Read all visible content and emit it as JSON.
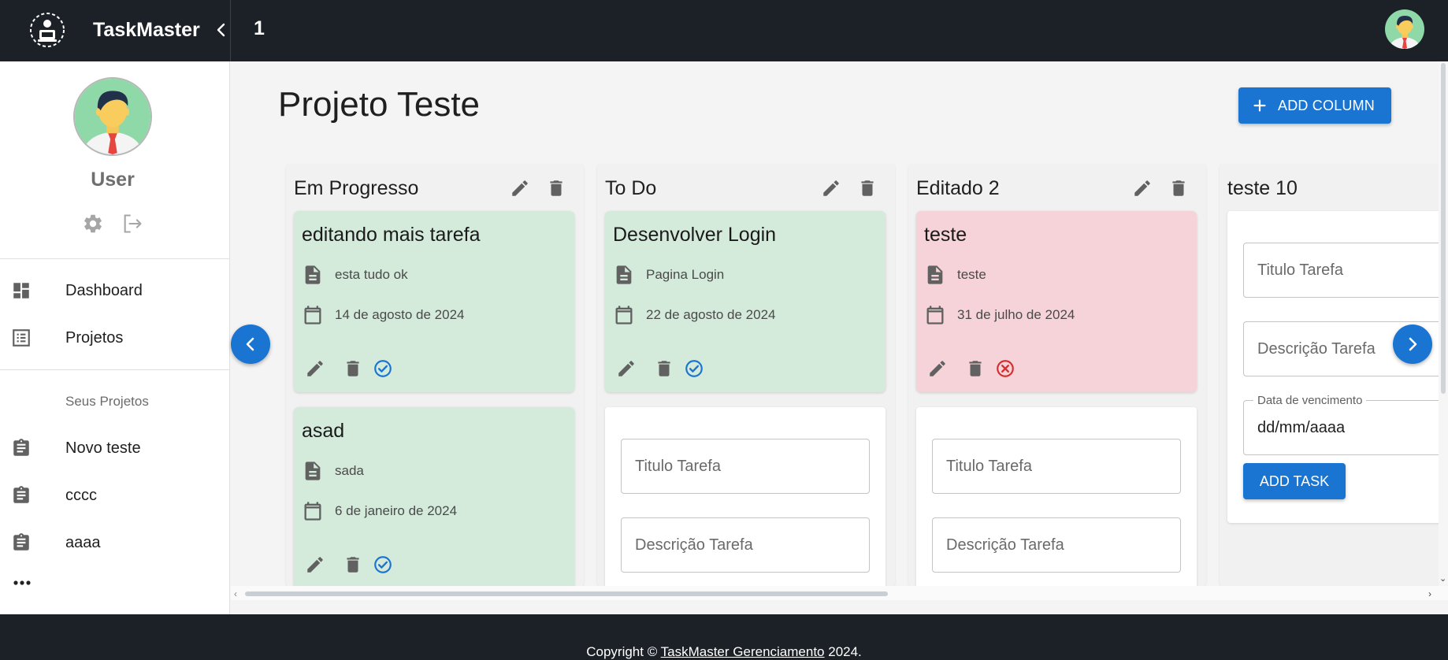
{
  "app": {
    "name": "TaskMaster",
    "page_number": "1"
  },
  "sidebar": {
    "user_name": "User",
    "nav": [
      {
        "label": "Dashboard",
        "icon": "dashboard-icon"
      },
      {
        "label": "Projetos",
        "icon": "list-icon"
      }
    ],
    "section_label": "Seus Projetos",
    "projects": [
      {
        "label": "Novo teste",
        "icon": "clipboard-icon"
      },
      {
        "label": "cccc",
        "icon": "clipboard-icon"
      },
      {
        "label": "aaaa",
        "icon": "clipboard-icon"
      }
    ]
  },
  "main": {
    "title": "Projeto Teste",
    "add_column_label": "ADD COLUMN",
    "columns": [
      {
        "title": "Em Progresso",
        "cards": [
          {
            "title": "editando mais tarefa",
            "description": "esta tudo ok",
            "date": "14 de agosto de 2024",
            "status": "done"
          },
          {
            "title": "asad",
            "description": "sada",
            "date": "6 de janeiro de 2024",
            "status": "done"
          }
        ]
      },
      {
        "title": "To Do",
        "cards": [
          {
            "title": "Desenvolver Login",
            "description": "Pagina Login",
            "date": "22 de agosto de 2024",
            "status": "done"
          }
        ],
        "form": {
          "title_placeholder": "Titulo Tarefa",
          "description_placeholder": "Descrição Tarefa"
        }
      },
      {
        "title": "Editado 2",
        "cards": [
          {
            "title": "teste",
            "description": "teste",
            "date": "31 de julho de 2024",
            "status": "overdue"
          }
        ],
        "form": {
          "title_placeholder": "Titulo Tarefa",
          "description_placeholder": "Descrição Tarefa"
        }
      },
      {
        "title": "teste 10",
        "form": {
          "title_placeholder": "Titulo Tarefa",
          "description_placeholder": "Descrição Tarefa",
          "date_label": "Data de vencimento",
          "date_value": "dd/mm/aaaa",
          "add_task_label": "ADD TASK"
        }
      }
    ]
  },
  "footer": {
    "prefix": "Copyright © ",
    "link": "TaskMaster Gerenciamento",
    "suffix": " 2024."
  },
  "colors": {
    "accent": "#1a74d2",
    "header_bg": "#1b2127",
    "card_done": "#d4ebdc",
    "card_overdue": "#f6d3d8",
    "status_done": "#1a74d2",
    "status_overdue": "#d32f2f"
  }
}
